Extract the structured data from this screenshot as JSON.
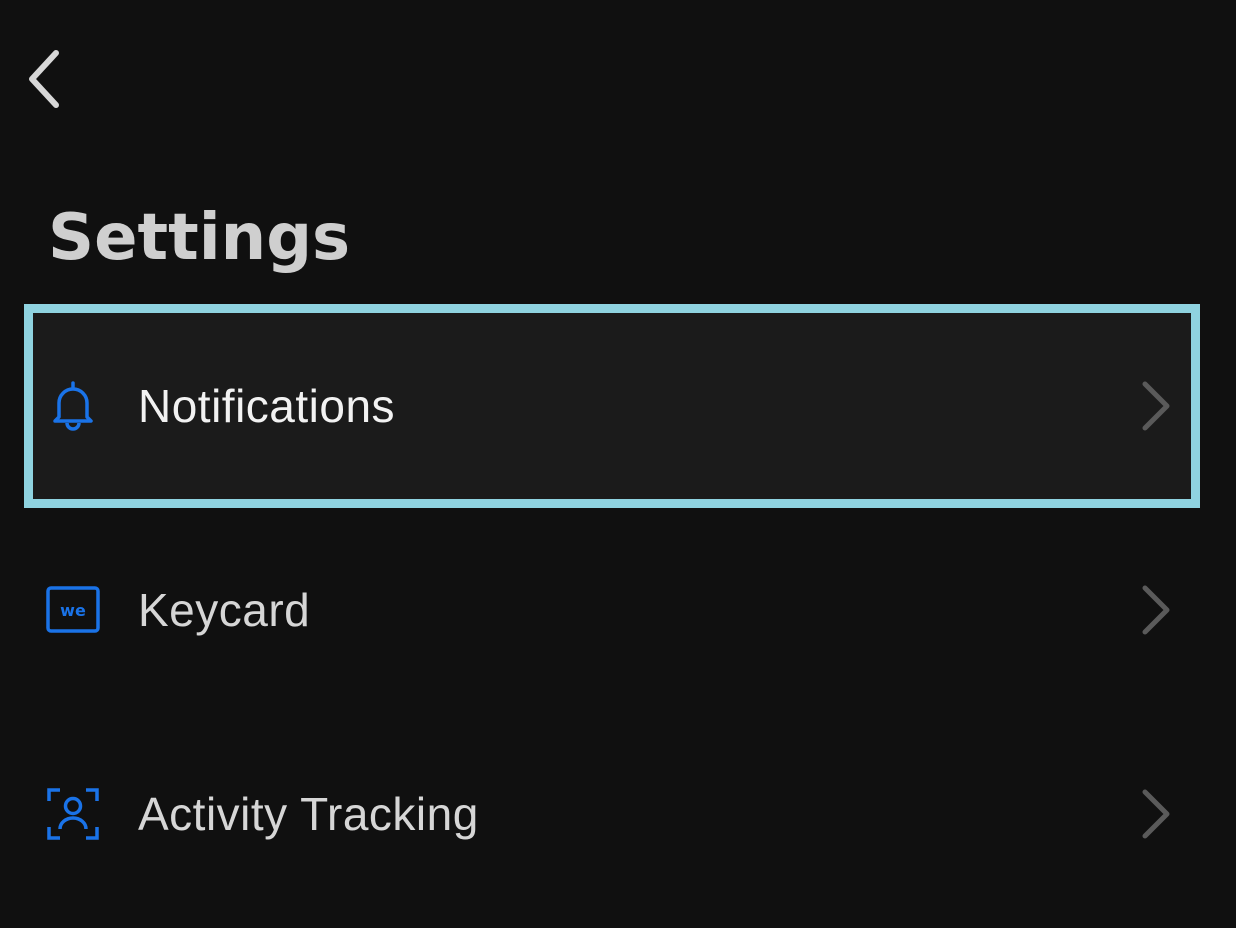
{
  "header": {
    "title": "Settings",
    "back_icon": "chevron-left-icon"
  },
  "items": [
    {
      "label": "Notifications",
      "icon": "bell-icon",
      "focused": true
    },
    {
      "label": "Keycard",
      "icon": "keycard-icon",
      "icon_text": "we"
    },
    {
      "label": "Activity Tracking",
      "icon": "person-scan-icon"
    }
  ],
  "colors": {
    "background": "#101010",
    "focus_outline": "#8fd3e0",
    "icon_accent": "#1a73e8",
    "chevron": "#5a5a5a",
    "title": "#cfcfcf"
  }
}
